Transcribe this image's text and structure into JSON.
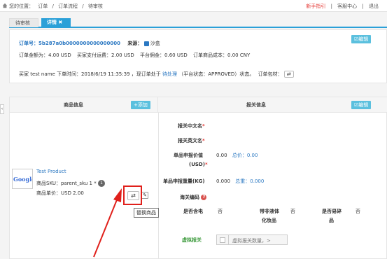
{
  "topbar": {
    "crumbs": [
      "您的位置：",
      "订单",
      "/",
      "订单流程",
      "/",
      "待审核"
    ],
    "links": [
      "新手指引",
      "|",
      "客服中心",
      "|",
      "退出"
    ]
  },
  "tabs": {
    "pending": "待审核",
    "detail": "详情 ✖"
  },
  "order": {
    "id_label": "订单号：",
    "id_value": "5b287a0b0000000000000000",
    "source_label": "来源：",
    "source_value": "沙盒",
    "edit": "编辑",
    "amount": "订单金额为：4.00 USD",
    "buyer_shipping": "买家支付运费：2.00 USD",
    "commission": "平台佣金：0.60 USD",
    "cost": "订单商品成本：0.00 CNY",
    "status_line_1": "买家 test name 下单时间：2018/6/19 11:35:39 ，现订单处于",
    "status_state": "待处理",
    "status_line_2": "（平台状态：APPROVED）状态。",
    "package_label": "订单包材："
  },
  "goods": {
    "header": "商品信息",
    "add_button": "添加",
    "logo_text": "Google",
    "name": "Test Product",
    "sku": "商品SKU：parent_sku 1 *",
    "qty": "1",
    "price": "商品单价：USD 2.00",
    "tooltip": "替换商品"
  },
  "customs": {
    "header": "报关信息",
    "edit": "编辑",
    "cn_name_label": "报关中文名",
    "en_name_label": "报关英文名",
    "unit_value_label": "单品申报价值",
    "unit_value_unit": "(USD)",
    "unit_value": "0.00",
    "total_price": "总价：0.00",
    "weight_label": "单品申报重量(KG)",
    "weight": "0.000",
    "total_weight": "总重：0.000",
    "hs_label": "海关编码",
    "battery_label": "是否含电",
    "battery_value": "否",
    "liquid_label_1": "带非液体",
    "liquid_label_2": "化妆品",
    "liquid_value": "否",
    "fragile_label_1": "是否易碎",
    "fragile_label_2": "品",
    "fragile_value": "否",
    "virtual_label": "虚拟报关",
    "virtual_placeholder": "虚拟报关数量，>"
  }
}
